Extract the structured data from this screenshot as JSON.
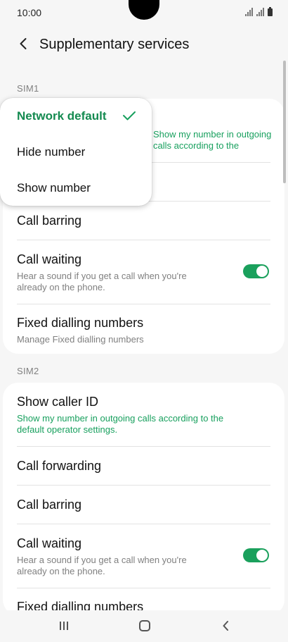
{
  "status": {
    "time": "10:00"
  },
  "header": {
    "title": "Supplementary services"
  },
  "sim1": {
    "label": "SIM1",
    "show_caller_id_sub": "Show my number in outgoing calls according to the",
    "call_barring": "Call barring",
    "call_waiting": {
      "title": "Call waiting",
      "sub": "Hear a sound if you get a call when you're\nalready on the phone.",
      "enabled": true
    },
    "fixed_dialling": {
      "title": "Fixed dialling numbers",
      "sub": "Manage Fixed dialling numbers"
    }
  },
  "menu": {
    "options": [
      {
        "label": "Network default",
        "selected": true
      },
      {
        "label": "Hide number",
        "selected": false
      },
      {
        "label": "Show number",
        "selected": false
      }
    ]
  },
  "sim2": {
    "label": "SIM2",
    "show_caller_id": {
      "title": "Show caller ID",
      "sub": "Show my number in outgoing calls according to the\ndefault operator settings."
    },
    "call_forwarding": "Call forwarding",
    "call_barring": "Call barring",
    "call_waiting": {
      "title": "Call waiting",
      "sub": "Hear a sound if you get a call when you're\nalready on the phone.",
      "enabled": true
    },
    "fixed_dialling_title": "Fixed dialling numbers"
  },
  "colors": {
    "accent": "#1aa05c",
    "background": "#f6f6f6",
    "card": "#ffffff"
  }
}
